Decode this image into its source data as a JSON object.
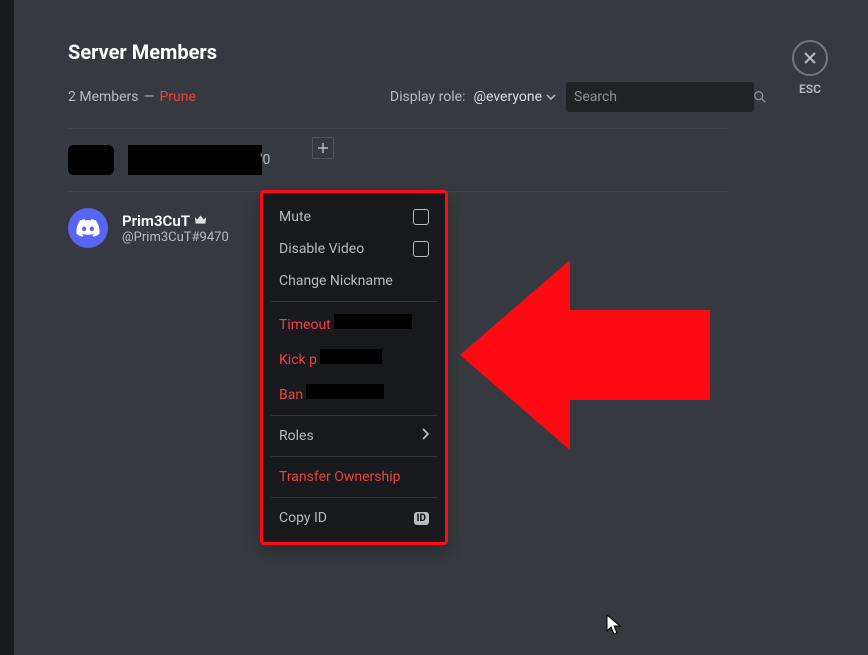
{
  "header": {
    "title": "Server Members",
    "member_count": "2 Members",
    "dash": "—",
    "prune": "Prune",
    "display_role_label": "Display role:",
    "role_selected": "@everyone",
    "search_placeholder": "Search",
    "esc_label": "ESC"
  },
  "members": [
    {
      "name_redacted": true,
      "suffix": "'0",
      "tag": ""
    },
    {
      "name": "Prim3CuT",
      "tag": "@Prim3CuT#9470",
      "owner": true
    }
  ],
  "context_menu": {
    "mute": "Mute",
    "disable_video": "Disable Video",
    "change_nick": "Change Nickname",
    "timeout": "Timeout",
    "kick": "Kick p",
    "ban": "Ban",
    "roles": "Roles",
    "transfer": "Transfer Ownership",
    "copy_id": "Copy ID",
    "id_badge": "ID"
  }
}
